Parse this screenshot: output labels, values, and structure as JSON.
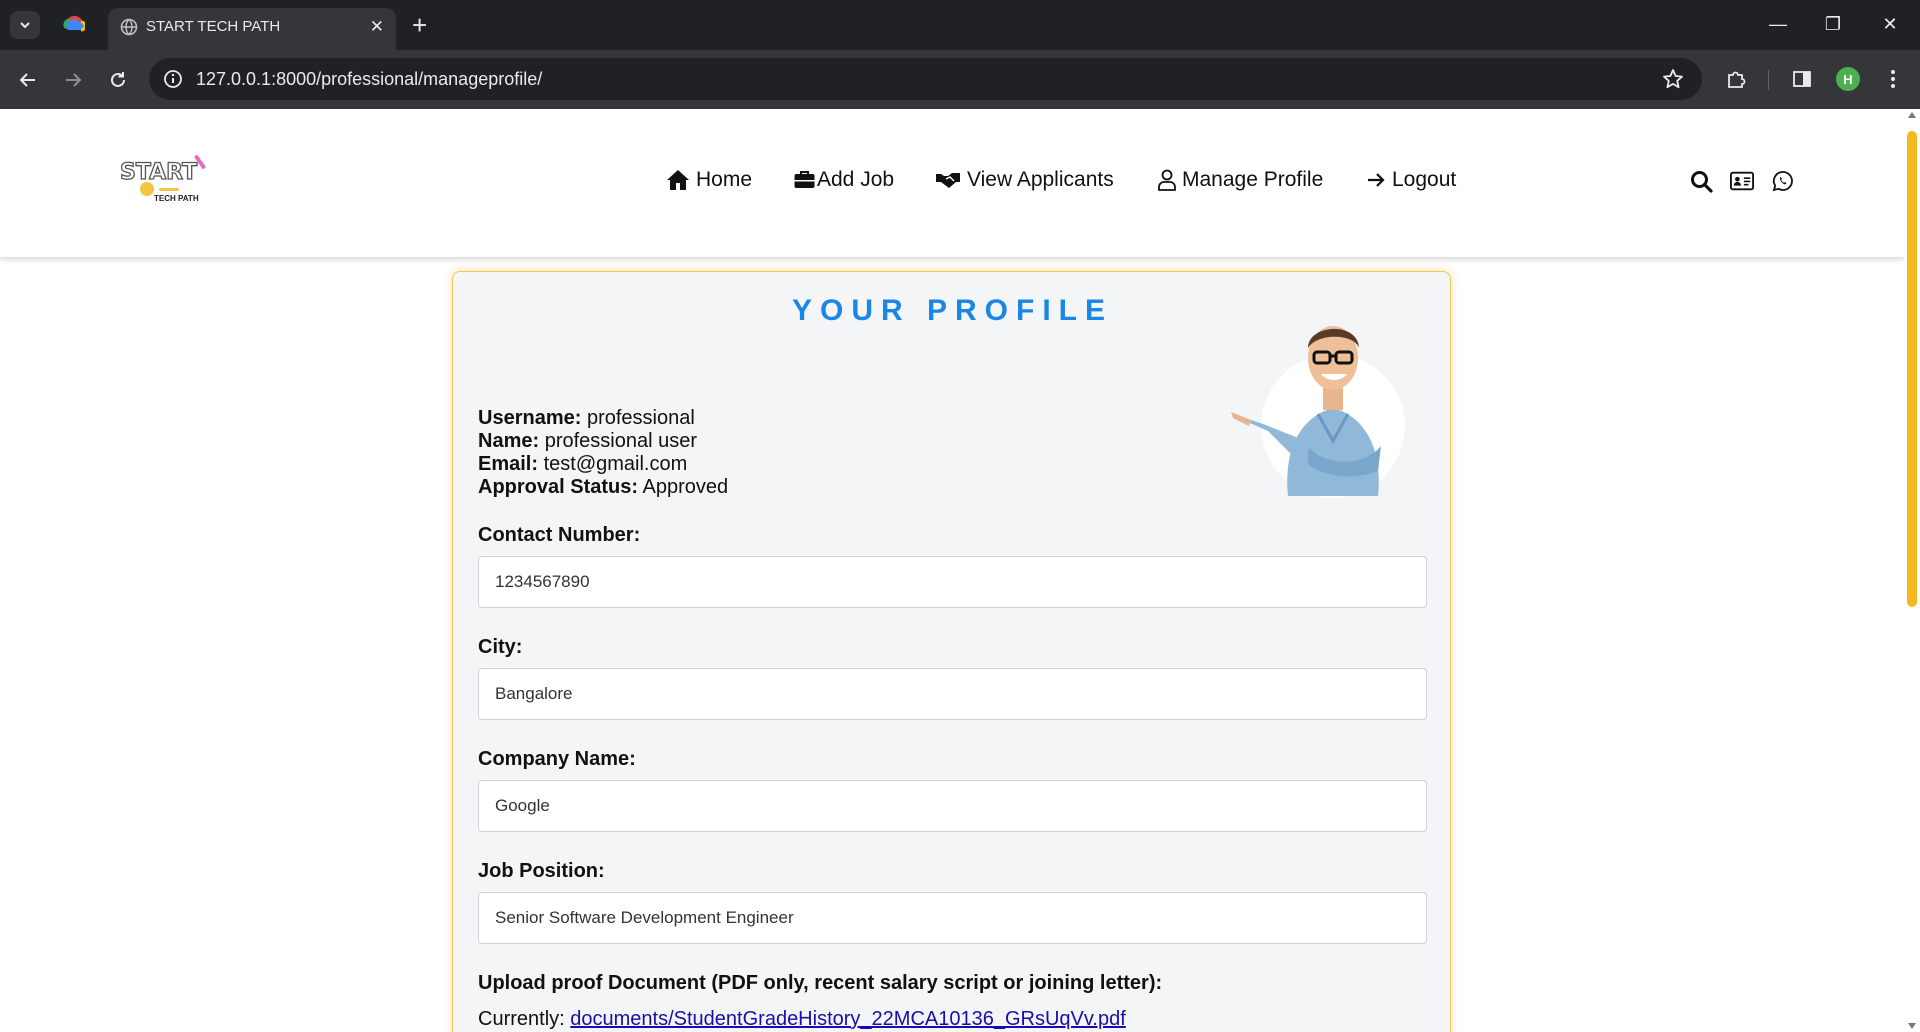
{
  "browser": {
    "tab_title": "START TECH PATH",
    "tab_close": "✕",
    "new_tab": "+",
    "url": "127.0.0.1:8000/professional/manageprofile/",
    "profile_initial": "H",
    "window_controls": {
      "minimize": "—",
      "restore": "❐",
      "close": "✕"
    }
  },
  "site": {
    "logo_text": "START",
    "logo_subtext": "TECH PATH",
    "nav": [
      {
        "label": "Home",
        "icon": "home-icon"
      },
      {
        "label": "Add Job",
        "icon": "briefcase-icon"
      },
      {
        "label": "View Applicants",
        "icon": "handshake-icon"
      },
      {
        "label": "Manage Profile",
        "icon": "user-icon"
      },
      {
        "label": "Logout",
        "icon": "arrow-right-icon"
      }
    ],
    "header_icons": [
      "search-icon",
      "id-card-icon",
      "whatsapp-icon"
    ]
  },
  "profile": {
    "title": "YOUR PROFILE",
    "username_label": "Username:",
    "username": "professional",
    "name_label": "Name:",
    "name": "professional user",
    "email_label": "Email:",
    "email": "test@gmail.com",
    "approval_label": "Approval Status:",
    "approval": "Approved",
    "contact_label": "Contact Number:",
    "contact_value": "1234567890",
    "city_label": "City:",
    "city_value": "Bangalore",
    "company_label": "Company Name:",
    "company_value": "Google",
    "position_label": "Job Position:",
    "position_value": "Senior Software Development Engineer",
    "upload_label": "Upload proof Document (PDF only, recent salary script or joining letter):",
    "currently_label": "Currently:",
    "current_file": "documents/StudentGradeHistory_22MCA10136_GRsUqVv.pdf"
  },
  "colors": {
    "accent_title": "#1a86e6",
    "card_border": "#f3c55a",
    "scroll_thumb": "#f4b81c"
  }
}
